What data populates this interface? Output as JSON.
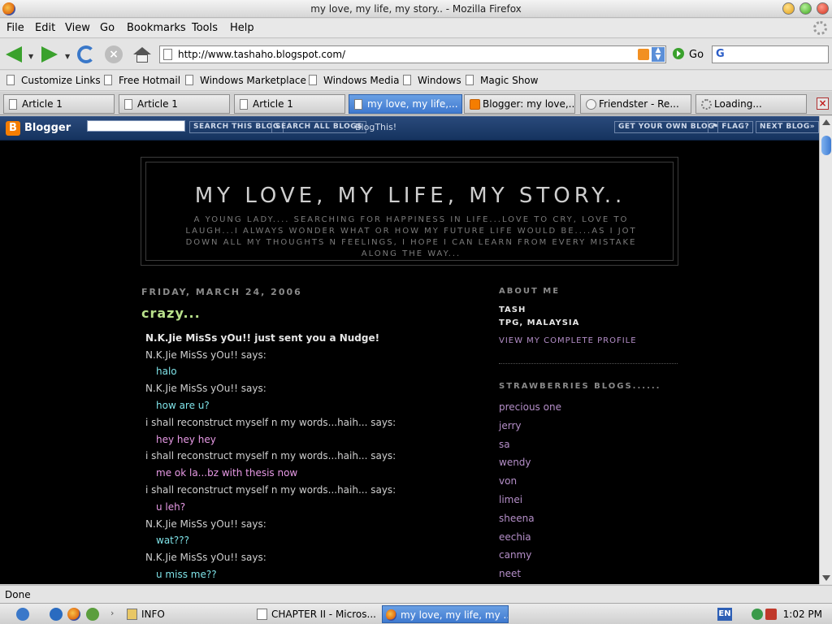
{
  "window": {
    "title": "my love, my life, my story.. - Mozilla Firefox"
  },
  "menu": [
    "File",
    "Edit",
    "View",
    "Go",
    "Bookmarks",
    "Tools",
    "Help"
  ],
  "nav": {
    "url": "http://www.tashaho.blogspot.com/",
    "go_label": "Go",
    "search_value": ""
  },
  "bookmarks": [
    "Customize Links",
    "Free Hotmail",
    "Windows Marketplace",
    "Windows Media",
    "Windows",
    "Magic Show"
  ],
  "tabs": [
    {
      "label": "Article 1"
    },
    {
      "label": "Article 1"
    },
    {
      "label": "Article 1"
    },
    {
      "label": "my love, my life,..."
    },
    {
      "label": "Blogger: my love,..."
    },
    {
      "label": "Friendster - Re..."
    },
    {
      "label": "Loading..."
    }
  ],
  "blogger_bar": {
    "brand": "Blogger",
    "search_blog": "SEARCH THIS BLOG",
    "search_all": "SEARCH ALL BLOGS",
    "blog_this": "BlogThis!",
    "get_own": "GET YOUR OWN BLOG",
    "flag": "FLAG?",
    "next": "NEXT BLOG»"
  },
  "blog": {
    "title": "MY LOVE, MY LIFE, MY STORY..",
    "description": "A YOUNG LADY.... SEARCHING FOR HAPPINESS IN LIFE...LOVE TO CRY, LOVE TO LAUGH...I ALWAYS WONDER WHAT OR HOW MY FUTURE LIFE WOULD BE....AS I JOT DOWN ALL MY THOUGHTS N FEELINGS, I HOPE I CAN LEARN FROM EVERY MISTAKE ALONG THE WAY..."
  },
  "post": {
    "date": "FRIDAY, MARCH 24, 2006",
    "title": "crazy...",
    "lines": [
      {
        "text": "N.K.Jie MisSs yOu!! just sent you a Nudge!",
        "kind": "nudge"
      },
      {
        "text": "N.K.Jie MisSs yOu!! says:",
        "kind": "speaker"
      },
      {
        "text": "halo",
        "kind": "msg-a"
      },
      {
        "text": "N.K.Jie MisSs yOu!! says:",
        "kind": "speaker"
      },
      {
        "text": "how are u?",
        "kind": "msg-a"
      },
      {
        "text": "i shall reconstruct myself n my words...haih... says:",
        "kind": "speaker"
      },
      {
        "text": "hey hey hey",
        "kind": "msg-b"
      },
      {
        "text": "i shall reconstruct myself n my words...haih... says:",
        "kind": "speaker"
      },
      {
        "text": "me ok la...bz with thesis now",
        "kind": "msg-b"
      },
      {
        "text": "i shall reconstruct myself n my words...haih... says:",
        "kind": "speaker"
      },
      {
        "text": "u leh?",
        "kind": "msg-b"
      },
      {
        "text": "N.K.Jie MisSs yOu!! says:",
        "kind": "speaker"
      },
      {
        "text": "wat???",
        "kind": "msg-a"
      },
      {
        "text": "N.K.Jie MisSs yOu!! says:",
        "kind": "speaker"
      },
      {
        "text": "u miss me??",
        "kind": "msg-a"
      }
    ]
  },
  "sidebar": {
    "about_heading": "ABOUT ME",
    "name": "TASH",
    "location": "TPG, MALAYSIA",
    "profile_link": "VIEW MY COMPLETE PROFILE",
    "blogs_heading": "STRAWBERRIES BLOGS......",
    "blogs": [
      "precious one",
      "jerry",
      "sa",
      "wendy",
      "von",
      "limei",
      "sheena",
      "eechia",
      "canmy",
      "neet"
    ]
  },
  "status": {
    "text": "Done"
  },
  "taskbar": {
    "items": [
      "INFO",
      "CHAPTER II - Micros...",
      "my love, my life, my ..."
    ],
    "lang": "EN",
    "clock": "1:02 PM"
  },
  "colors": {
    "page_bg": "#000000",
    "title_text": "#cfcfcf",
    "post_title": "#b8e08a",
    "msg_a": "#7fe3e8",
    "msg_b": "#e89ae6",
    "sidebar_link": "#b58fc9",
    "active_tab": "#3f79cf"
  },
  "icons": {
    "back": "arrow-left-icon",
    "forward": "arrow-right-icon",
    "reload": "reload-icon",
    "stop": "stop-icon",
    "home": "home-icon",
    "rss": "rss-feed-icon",
    "go": "go-icon",
    "tab_close": "close-icon"
  }
}
